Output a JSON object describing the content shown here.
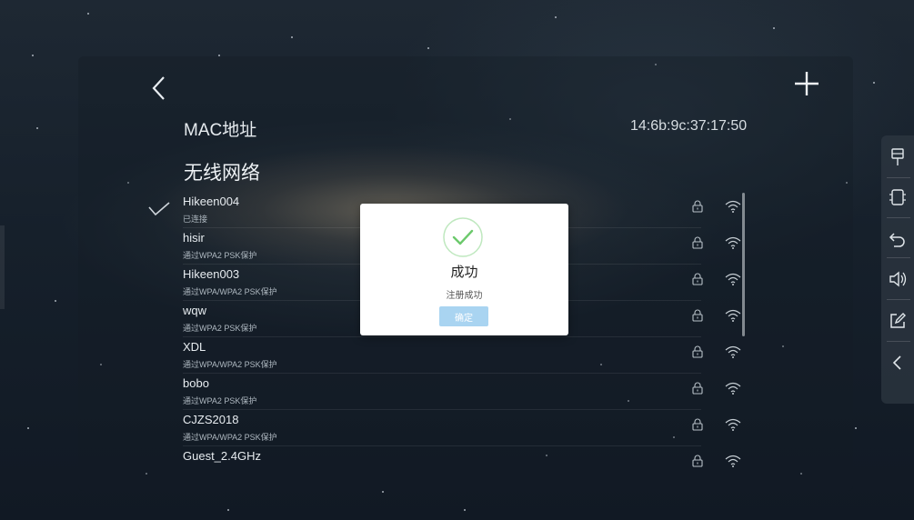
{
  "header": {
    "back_icon": "chevron-left-icon",
    "add_icon": "plus-icon"
  },
  "mac": {
    "label": "MAC地址",
    "value": "14:6b:9c:37:17:50"
  },
  "wifi": {
    "title": "无线网络",
    "connected_icon": "checkmark-icon",
    "networks": [
      {
        "name": "Hikeen004",
        "status": "已连接"
      },
      {
        "name": "hisir",
        "status": "通过WPA2 PSK保护"
      },
      {
        "name": "Hikeen003",
        "status": "通过WPA/WPA2 PSK保护"
      },
      {
        "name": "wqw",
        "status": "通过WPA2 PSK保护"
      },
      {
        "name": "XDL",
        "status": "通过WPA/WPA2 PSK保护"
      },
      {
        "name": "bobo",
        "status": "通过WPA2 PSK保护"
      },
      {
        "name": "CJZS2018",
        "status": "通过WPA/WPA2 PSK保护"
      },
      {
        "name": "Guest_2.4GHz",
        "status": ""
      }
    ]
  },
  "toolbar": {
    "icons": [
      "projector-icon",
      "device-icon",
      "return-icon",
      "volume-icon",
      "edit-icon",
      "collapse-icon"
    ]
  },
  "dialog": {
    "icon": "success-check-icon",
    "title": "成功",
    "message": "注册成功",
    "ok_label": "确定"
  },
  "colors": {
    "success_green": "#7ed27e",
    "button_blue": "#a9d4f1"
  }
}
